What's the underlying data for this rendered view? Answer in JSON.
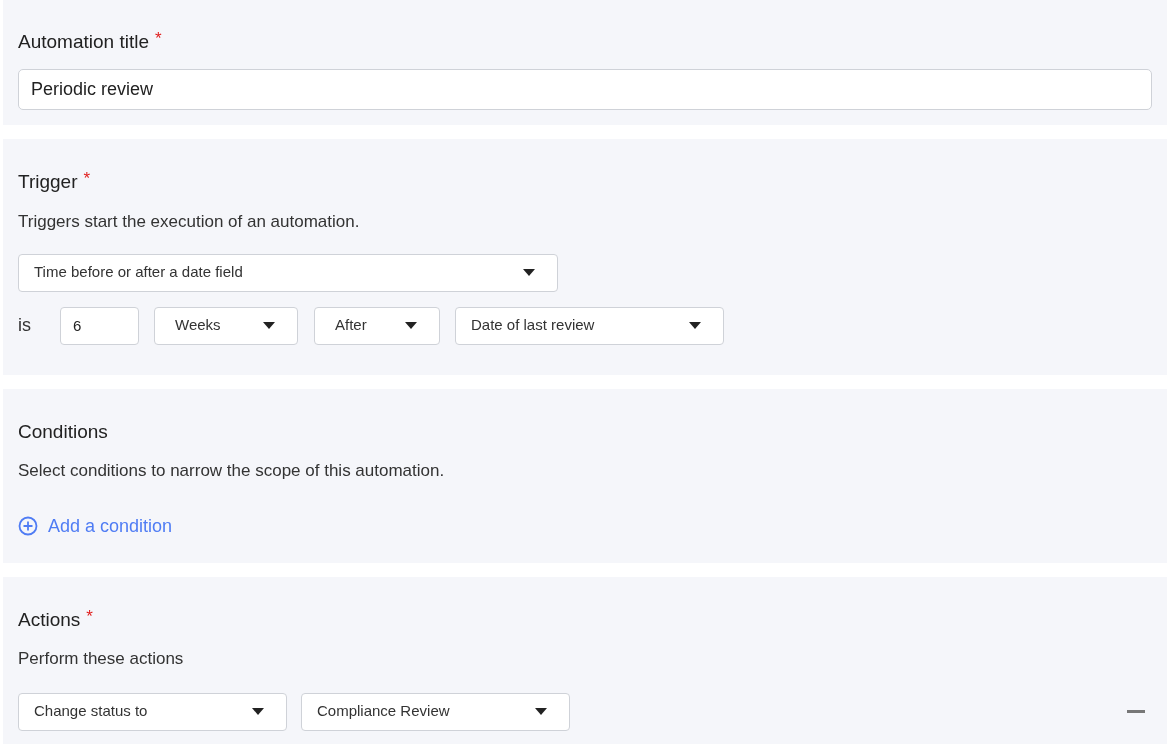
{
  "title_section": {
    "heading": "Automation title",
    "required_mark": "*",
    "value": "Periodic review"
  },
  "trigger": {
    "heading": "Trigger",
    "required_mark": "*",
    "description": "Triggers start the execution of an automation.",
    "trigger_type": "Time before or after a date field",
    "is_label": "is",
    "amount": "6",
    "unit": "Weeks",
    "direction": "After",
    "date_field": "Date of last review"
  },
  "conditions": {
    "heading": "Conditions",
    "description": "Select conditions to narrow the scope of this automation.",
    "add_link": "Add a condition"
  },
  "actions": {
    "heading": "Actions",
    "required_mark": "*",
    "description": "Perform these actions",
    "rows": [
      {
        "action": "Change status to",
        "value": "Compliance Review"
      }
    ]
  }
}
